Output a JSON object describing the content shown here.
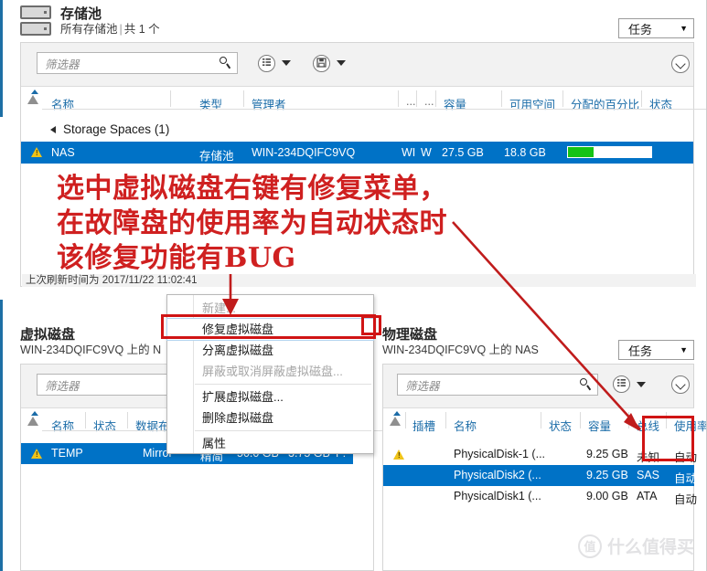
{
  "pools_pane": {
    "title": "存储池",
    "subtitle_all": "所有存储池",
    "subtitle_sep": "|",
    "subtitle_count": "共 1 个",
    "tasks_label": "任务",
    "tasks_caret": "▼",
    "filter_placeholder": "筛选器",
    "icon_list": "list-view-icon",
    "icon_save": "save-icon",
    "columns": [
      {
        "label": "名称"
      },
      {
        "label": "类型"
      },
      {
        "label": "管理者"
      },
      {
        "label": "..."
      },
      {
        "label": "..."
      },
      {
        "label": "容量"
      },
      {
        "label": "可用空间"
      },
      {
        "label": "分配的百分比"
      },
      {
        "label": "状态"
      }
    ],
    "group_label": "Storage Spaces (1)",
    "rows": [
      {
        "status_icon": "warning-icon",
        "name": "NAS",
        "type": "存储池",
        "manager": "WIN-234DQIFC9VQ",
        "col_a": "WI",
        "col_b": "W",
        "capacity": "27.5 GB",
        "free": "18.8 GB",
        "allocated_percent": 31,
        "selected": true
      }
    ],
    "refresh_note": "上次刷新时间为 2017/11/22 11:02:41"
  },
  "virtual_disks_pane": {
    "title": "虚拟磁盘",
    "subtitle": "WIN-234DQIFC9VQ 上的 N",
    "filter_placeholder": "筛选器",
    "columns": [
      {
        "label": "名称"
      },
      {
        "label": "状态"
      },
      {
        "label": "数据布局"
      }
    ],
    "rows": [
      {
        "status_icon": "warning-icon",
        "name": "TEMP",
        "layout": "Mirror",
        "provisioning": "精简",
        "capacity": "50.0 GB",
        "used": "3.75 GB",
        "drive": "F:",
        "selected": true
      }
    ]
  },
  "physical_disks_pane": {
    "title": "物理磁盘",
    "subtitle": "WIN-234DQIFC9VQ 上的 NAS",
    "tasks_label": "任务",
    "tasks_caret": "▼",
    "filter_placeholder": "筛选器",
    "icon_list": "list-view-icon",
    "columns": [
      {
        "label": "插槽"
      },
      {
        "label": "名称"
      },
      {
        "label": "状态"
      },
      {
        "label": "容量"
      },
      {
        "label": "总线"
      },
      {
        "label": "使用率"
      }
    ],
    "rows": [
      {
        "status_icon": "warning-icon",
        "slot": "",
        "name": "PhysicalDisk-1 (...",
        "state": "",
        "capacity": "9.25 GB",
        "bus": "未知",
        "usage": "自动",
        "selected": false
      },
      {
        "status_icon": "",
        "slot": "",
        "name": "PhysicalDisk2 (...",
        "state": "",
        "capacity": "9.25 GB",
        "bus": "SAS",
        "usage": "自动",
        "selected": true
      },
      {
        "status_icon": "",
        "slot": "",
        "name": "PhysicalDisk1 (...",
        "state": "",
        "capacity": "9.00 GB",
        "bus": "ATA",
        "usage": "自动",
        "selected": false
      }
    ]
  },
  "context_menu": {
    "items": [
      {
        "label": "新建...",
        "disabled": true,
        "highlighted": false,
        "separator_after": false
      },
      {
        "label": "修复虚拟磁盘",
        "disabled": false,
        "highlighted": true,
        "separator_after": false
      },
      {
        "label": "分离虚拟磁盘",
        "disabled": false,
        "highlighted": false,
        "separator_after": false
      },
      {
        "label": "屏蔽或取消屏蔽虚拟磁盘...",
        "disabled": true,
        "highlighted": false,
        "separator_after": true
      },
      {
        "label": "扩展虚拟磁盘...",
        "disabled": false,
        "highlighted": false,
        "separator_after": false
      },
      {
        "label": "删除虚拟磁盘",
        "disabled": false,
        "highlighted": false,
        "separator_after": true
      },
      {
        "label": "属性",
        "disabled": false,
        "highlighted": false,
        "separator_after": false
      }
    ]
  },
  "annotation": {
    "line1": "选中虚拟磁盘右键有修复菜单，",
    "line2": "在故障盘的使用率为自动状态时",
    "line3": "该修复功能有BUG",
    "color": "#cf2020"
  },
  "watermark": {
    "mark": "值",
    "text": "什么值得买"
  },
  "colors": {
    "selection_blue": "#0072c6",
    "header_link_blue": "#1b6ca8",
    "warning_yellow": "#f0c419",
    "progress_green": "#15c315",
    "annotation_red": "#cf2020",
    "accent_strip": "#1d6fa5"
  }
}
